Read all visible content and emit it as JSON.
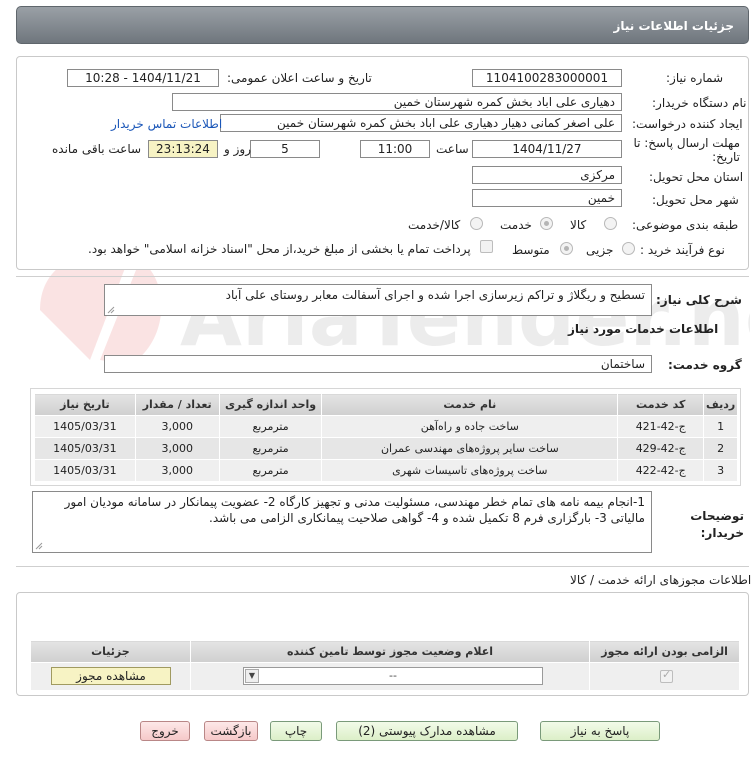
{
  "header": {
    "title": "جزئیات اطلاعات نیاز"
  },
  "form": {
    "need_number_label": "شماره نیاز:",
    "need_number": "1104100283000001",
    "announce_label": "تاریخ و ساعت اعلان عمومی:",
    "announce_value": "1404/11/21 - 10:28",
    "buyer_label": "نام دستگاه خریدار:",
    "buyer_value": "دهیاری علی اباد بخش کمره شهرستان خمین",
    "creator_label": "ایجاد کننده درخواست:",
    "creator_value": "علی اصغر کمانی دهیار دهیاری علی اباد بخش کمره شهرستان خمین",
    "contact_link": "اطلاعات تماس خریدار",
    "deadline_label": "مهلت ارسال پاسخ: تا تاریخ:",
    "deadline_date": "1404/11/27",
    "time_label": "ساعت",
    "deadline_time": "11:00",
    "days_value": "5",
    "days_label": "روز و",
    "remaining_value": "23:13:24",
    "remaining_label": "ساعت باقی مانده",
    "province_label": "استان محل تحویل:",
    "province_value": "مرکزی",
    "city_label": "شهر محل تحویل:",
    "city_value": "خمین",
    "category_label": "طبقه بندی موضوعی:",
    "category_options": [
      "کالا",
      "خدمت",
      "کالا/خدمت"
    ],
    "process_label": "نوع فرآیند خرید :",
    "process_options": [
      "جزیی",
      "متوسط"
    ],
    "payment_note": "پرداخت تمام یا بخشی از مبلغ خرید،از محل \"اسناد خزانه اسلامی\" خواهد بود."
  },
  "description": {
    "label": "شرح کلی نیاز:",
    "value": "تسطیح و ریگلاژ و تراکم زیرسازی اجرا شده و اجرای آسفالت معابر روستای علی آباد"
  },
  "services": {
    "section_title": "اطلاعات خدمات مورد نیاز",
    "group_label": "گروه خدمت:",
    "group_value": "ساختمان",
    "columns": [
      "ردیف",
      "کد خدمت",
      "نام خدمت",
      "واحد اندازه گیری",
      "تعداد / مقدار",
      "تاریخ نیاز"
    ],
    "rows": [
      [
        "1",
        "ج-42-421",
        "ساخت جاده و راه‌آهن",
        "مترمربع",
        "3,000",
        "1405/03/31"
      ],
      [
        "2",
        "ج-42-429",
        "ساخت سایر پروژه‌های مهندسی عمران",
        "مترمربع",
        "3,000",
        "1405/03/31"
      ],
      [
        "3",
        "ج-42-422",
        "ساخت پروژه‌های تاسیسات شهری",
        "مترمربع",
        "3,000",
        "1405/03/31"
      ]
    ]
  },
  "buyer_notes": {
    "label": "توضیحات خریدار:",
    "value": "1-انجام بیمه نامه های تمام خطر مهندسی، مسئولیت مدنی و تجهیز کارگاه  2- عضویت پیمانکار در سامانه مودیان امور مالیاتی 3- بارگزاری فرم 8 تکمیل شده و 4- گواهی صلاحیت پیمانکاری الزامی می باشد."
  },
  "permits": {
    "section_title": "اطلاعات مجوزهای ارائه خدمت / کالا",
    "columns": [
      "الزامی بودن ارائه مجوز",
      "اعلام وضعیت مجوز توسط تامین کننده",
      "جزئیات"
    ],
    "select_value": "--",
    "view_button": "مشاهده مجوز"
  },
  "actions": {
    "reply": "پاسخ به نیاز",
    "attachments": "مشاهده مدارک پیوستی (2)",
    "print": "چاپ",
    "back": "بازگشت",
    "exit": "خروج"
  },
  "watermark": {
    "text": "AriaTender.neT"
  }
}
